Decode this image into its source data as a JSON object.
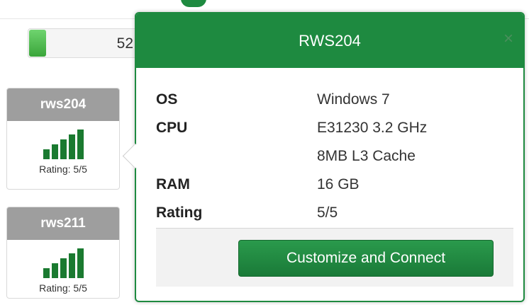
{
  "progress": {
    "value_text": "52",
    "fraction": 0.14
  },
  "workstations": [
    {
      "name": "rws204",
      "rating_text": "Rating: 5/5"
    },
    {
      "name": "rws211",
      "rating_text": "Rating: 5/5"
    }
  ],
  "popover": {
    "title": "RWS204",
    "close_glyph": "×",
    "specs": {
      "os_label": "OS",
      "os_value": "Windows 7",
      "cpu_label": "CPU",
      "cpu_value": "E31230 3.2 GHz",
      "cpu_cache": "8MB L3 Cache",
      "ram_label": "RAM",
      "ram_value": "16 GB",
      "rating_label": "Rating",
      "rating_value": "5/5"
    },
    "connect_label": "Customize and Connect"
  },
  "colors": {
    "brand_green": "#1e8a40",
    "card_header": "#9e9e9e",
    "signal": "#1a7a30"
  }
}
